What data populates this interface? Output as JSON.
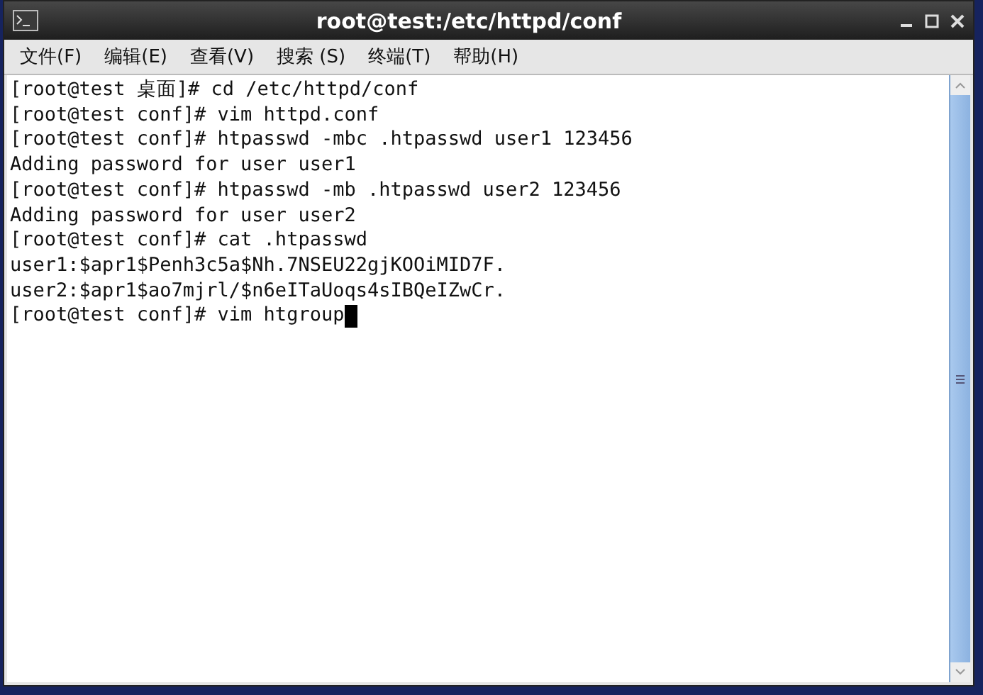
{
  "window": {
    "title": "root@test:/etc/httpd/conf"
  },
  "menu": [
    "文件(F)",
    "编辑(E)",
    "查看(V)",
    "搜索 (S)",
    "终端(T)",
    "帮助(H)"
  ],
  "terminal": {
    "cursor": true,
    "lines": [
      "[root@test 桌面]# cd /etc/httpd/conf",
      "[root@test conf]# vim httpd.conf",
      "[root@test conf]# htpasswd -mbc .htpasswd user1 123456",
      "Adding password for user user1",
      "[root@test conf]# htpasswd -mb .htpasswd user2 123456",
      "Adding password for user user2",
      "[root@test conf]# cat .htpasswd",
      "user1:$apr1$Penh3c5a$Nh.7NSEU22gjKOOiMID7F.",
      "user2:$apr1$ao7mjrl/$n6eITaUoqs4sIBQeIZwCr.",
      "[root@test conf]# vim htgroup"
    ]
  }
}
